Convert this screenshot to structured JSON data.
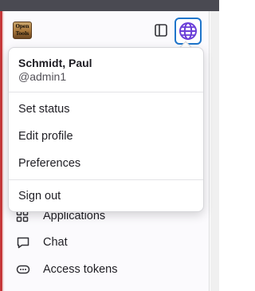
{
  "app": {
    "logo_text": [
      "Open",
      "Tools"
    ]
  },
  "user_menu": {
    "name": "Schmidt, Paul",
    "handle": "@admin1",
    "items_group1": [
      {
        "label": "Set status"
      },
      {
        "label": "Edit profile"
      },
      {
        "label": "Preferences"
      }
    ],
    "sign_out_label": "Sign out"
  },
  "sidebar": {
    "items": [
      {
        "label": "Applications",
        "icon": "applications-icon"
      },
      {
        "label": "Chat",
        "icon": "chat-icon"
      },
      {
        "label": "Access tokens",
        "icon": "access-tokens-icon"
      }
    ]
  },
  "colors": {
    "accent": "#1f75cb",
    "avatar_purple": "#6b3fd8"
  }
}
